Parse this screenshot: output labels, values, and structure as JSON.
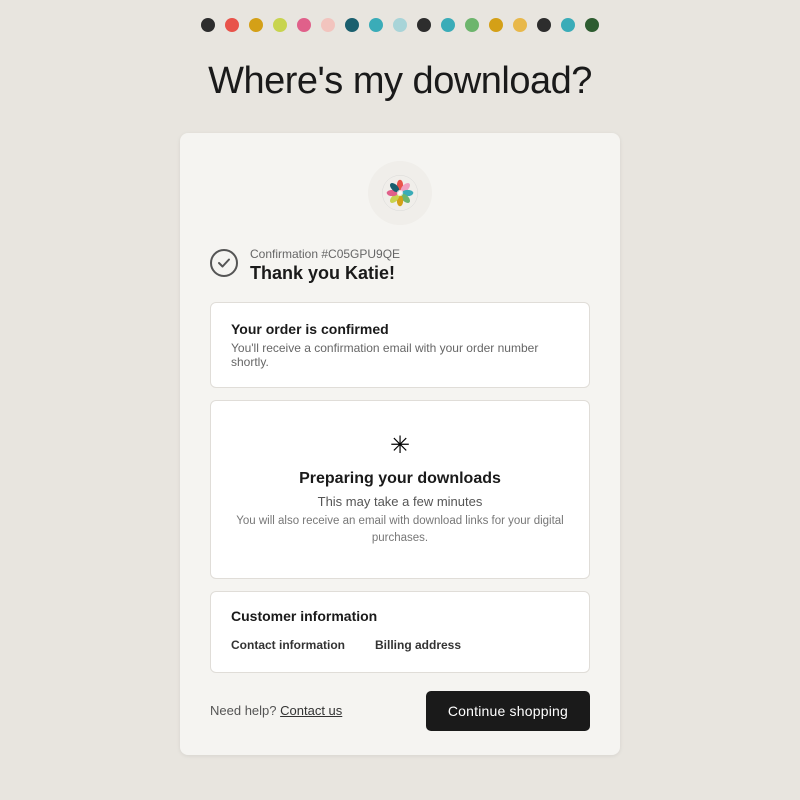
{
  "dots": [
    {
      "color": "#2d2d2d"
    },
    {
      "color": "#e8534a"
    },
    {
      "color": "#d4a017"
    },
    {
      "color": "#c8d44e"
    },
    {
      "color": "#e0608a"
    },
    {
      "color": "#f2c4be"
    },
    {
      "color": "#1a5f6e"
    },
    {
      "color": "#3aacb8"
    },
    {
      "color": "#a8d4d8"
    },
    {
      "color": "#2d2d2d"
    },
    {
      "color": "#3aacb8"
    },
    {
      "color": "#6db56d"
    },
    {
      "color": "#d4a017"
    },
    {
      "color": "#e8b84a"
    },
    {
      "color": "#2d2d2d"
    },
    {
      "color": "#3aacb8"
    },
    {
      "color": "#2d5c30"
    }
  ],
  "page": {
    "title": "Where's my download?"
  },
  "confirmation": {
    "number": "Confirmation #C05GPU9QE",
    "thank_you": "Thank you Katie!"
  },
  "order_box": {
    "title": "Your order is confirmed",
    "description": "You'll receive a confirmation email with your order number shortly."
  },
  "download_box": {
    "title": "Preparing your downloads",
    "subtitle": "This may take a few minutes",
    "note": "You will also receive an email with download links for your digital purchases."
  },
  "customer_box": {
    "title": "Customer information",
    "contact_label": "Contact information",
    "billing_label": "Billing address"
  },
  "footer": {
    "need_help_text": "Need help?",
    "contact_link": "Contact us",
    "continue_button": "Continue shopping"
  }
}
